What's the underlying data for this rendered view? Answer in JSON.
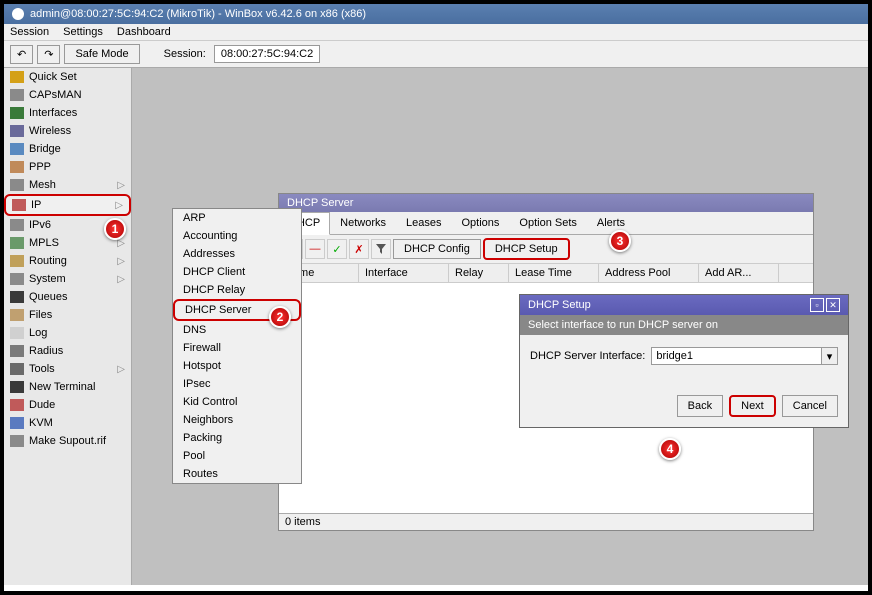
{
  "titlebar": {
    "text": "admin@08:00:27:5C:94:C2 (MikroTik) - WinBox v6.42.6 on x86 (x86)"
  },
  "menubar": {
    "session": "Session",
    "settings": "Settings",
    "dashboard": "Dashboard"
  },
  "toolbar": {
    "undo_icon": "↶",
    "redo_icon": "↷",
    "safe_mode": "Safe Mode",
    "session_label": "Session:",
    "session_value": "08:00:27:5C:94:C2"
  },
  "sidebar": {
    "items": [
      {
        "label": "Quick Set",
        "icon": "#d4a017"
      },
      {
        "label": "CAPsMAN",
        "icon": "#8a8a8a"
      },
      {
        "label": "Interfaces",
        "icon": "#3a7a3a"
      },
      {
        "label": "Wireless",
        "icon": "#6a6a9a"
      },
      {
        "label": "Bridge",
        "icon": "#5a8ac0"
      },
      {
        "label": "PPP",
        "icon": "#c08a5a"
      },
      {
        "label": "Mesh",
        "icon": "#8a8a8a",
        "arrow": true
      },
      {
        "label": "IP",
        "icon": "#c05a5a",
        "arrow": true,
        "highlight": true
      },
      {
        "label": "IPv6",
        "icon": "#8a8a8a",
        "arrow": true
      },
      {
        "label": "MPLS",
        "icon": "#6a9a6a",
        "arrow": true
      },
      {
        "label": "Routing",
        "icon": "#c0a05a",
        "arrow": true
      },
      {
        "label": "System",
        "icon": "#8a8a8a",
        "arrow": true
      },
      {
        "label": "Queues",
        "icon": "#3a3a3a"
      },
      {
        "label": "Files",
        "icon": "#c0a070"
      },
      {
        "label": "Log",
        "icon": "#d0d0d0"
      },
      {
        "label": "Radius",
        "icon": "#7a7a7a"
      },
      {
        "label": "Tools",
        "icon": "#6a6a6a",
        "arrow": true
      },
      {
        "label": "New Terminal",
        "icon": "#3a3a3a"
      },
      {
        "label": "Dude",
        "icon": "#c05a5a"
      },
      {
        "label": "KVM",
        "icon": "#5a7ac0"
      },
      {
        "label": "Make Supout.rif",
        "icon": "#8a8a8a"
      }
    ]
  },
  "submenu": {
    "items": [
      {
        "label": "ARP"
      },
      {
        "label": "Accounting"
      },
      {
        "label": "Addresses"
      },
      {
        "label": "DHCP Client"
      },
      {
        "label": "DHCP Relay"
      },
      {
        "label": "DHCP Server",
        "highlight": true
      },
      {
        "label": "DNS"
      },
      {
        "label": "Firewall"
      },
      {
        "label": "Hotspot"
      },
      {
        "label": "IPsec"
      },
      {
        "label": "Kid Control"
      },
      {
        "label": "Neighbors"
      },
      {
        "label": "Packing"
      },
      {
        "label": "Pool"
      },
      {
        "label": "Routes"
      }
    ]
  },
  "dhcp_window": {
    "title": "DHCP Server",
    "tabs": [
      "DHCP",
      "Networks",
      "Leases",
      "Options",
      "Option Sets",
      "Alerts"
    ],
    "active_tab": "DHCP",
    "toolbar": {
      "add": "✚",
      "remove": "—",
      "enable": "✓",
      "disable": "✗",
      "filter": "▼",
      "dhcp_config": "DHCP Config",
      "dhcp_setup": "DHCP Setup"
    },
    "columns": [
      "Name",
      "Interface",
      "Relay",
      "Lease Time",
      "Address Pool",
      "Add AR..."
    ],
    "status": "0 items"
  },
  "setup_dialog": {
    "title": "DHCP Setup",
    "instruction": "Select interface to run DHCP server on",
    "field_label": "DHCP Server Interface:",
    "field_value": "bridge1",
    "back": "Back",
    "next": "Next",
    "cancel": "Cancel"
  },
  "badges": {
    "b1": "1",
    "b2": "2",
    "b3": "3",
    "b4": "4"
  }
}
